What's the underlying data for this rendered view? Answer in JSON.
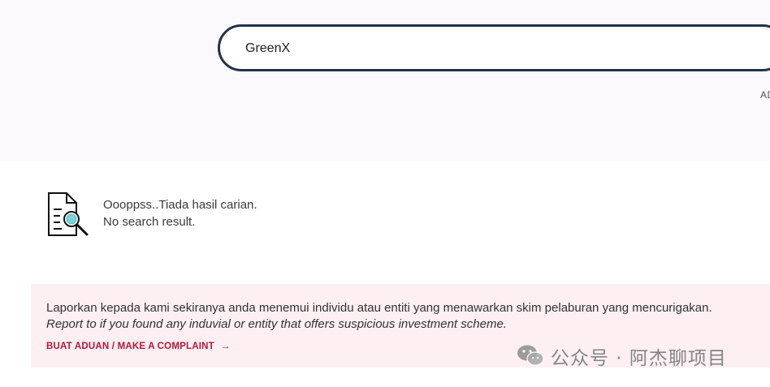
{
  "search": {
    "value": "GreenX",
    "advanced_label": "AD"
  },
  "no_result": {
    "icon": "document-search-icon",
    "line1": "Oooppss..Tiada hasil carian.",
    "line2": "No search result."
  },
  "report": {
    "text_ms": "Laporkan kepada kami sekiranya anda menemui individu atau entiti yang menawarkan skim pelaburan yang mencurigakan.",
    "text_en": "Report to if you found any induvial or entity that offers suspicious investment scheme.",
    "link_label": "BUAT ADUAN / MAKE A COMPLAINT",
    "link_arrow": "→"
  },
  "watermark": {
    "icon": "wechat-icon",
    "text": "公众号 · 阿杰聊项目"
  },
  "colors": {
    "search_border": "#22324a",
    "report_bg": "#fdeff2",
    "link": "#b3173a",
    "top_band": "#fbf9fc"
  }
}
